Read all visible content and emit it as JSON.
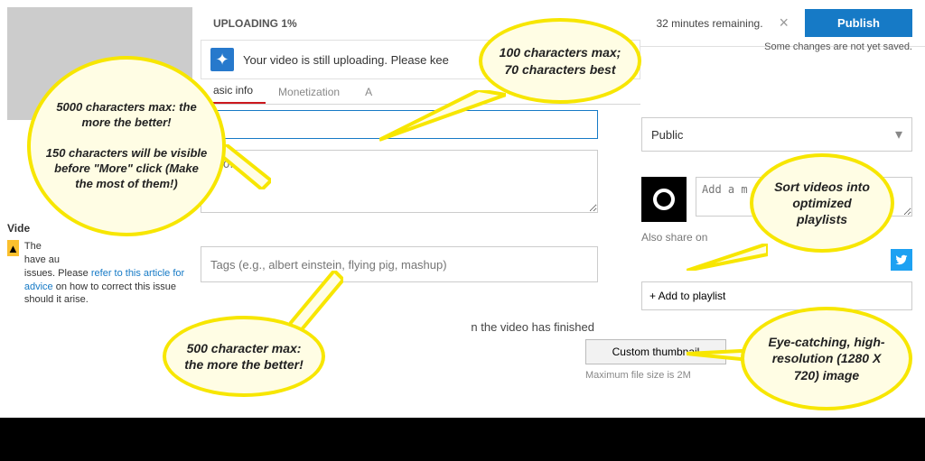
{
  "upload": {
    "status": "UPLOADING 1%",
    "time_remaining": "32 minutes remaining.",
    "save_msg": "Some changes are not yet saved."
  },
  "buttons": {
    "publish": "Publish",
    "add_playlist": "+ Add to playlist",
    "custom_thumb": "Custom thumbnail"
  },
  "notice": {
    "text": "Your video is still uploading. Please kee"
  },
  "tabs": {
    "basic": "asic info",
    "monetization": "Monetization",
    "advanced": "A"
  },
  "fields": {
    "title_value": "",
    "desc_label": "tion",
    "tags_placeholder": "Tags (e.g., albert einstein, flying pig, mashup)",
    "msg_placeholder": "Add a m"
  },
  "privacy": {
    "selected": "Public"
  },
  "share": {
    "label": "Also share on"
  },
  "thumb_section": {
    "pending_text": "n the video has finished",
    "max_size": "Maximum file size is 2M"
  },
  "warning": {
    "heading": "Vide",
    "body_prefix": "The",
    "body_line2": "have au",
    "body_line3": "issues. Please ",
    "link_text": "refer to this article for advice",
    "body_suffix": " on how to correct this issue should it arise."
  },
  "callouts": {
    "title_tip": "100 characters max; 70 characters best",
    "desc_tip": "5000 characters max: the more the better!\n\n150 characters will be visible before \"More\" click (Make the most of them!)",
    "tags_tip": "500 character max: the more the better!",
    "playlist_tip": "Sort videos into optimized playlists",
    "thumb_tip": "Eye-catching, high-resolution (1280 X 720) image"
  }
}
